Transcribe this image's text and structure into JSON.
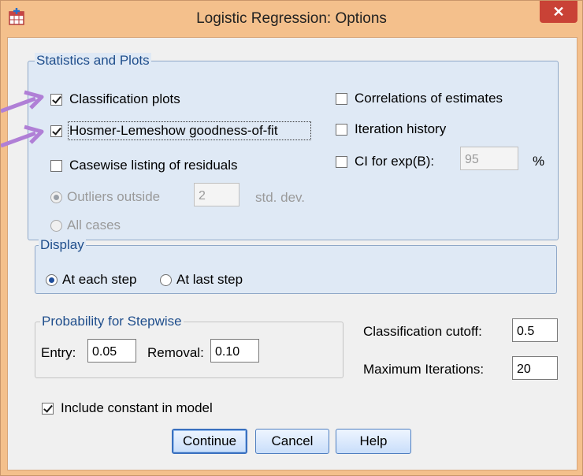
{
  "window": {
    "title": "Logistic Regression: Options",
    "close_glyph": "✕"
  },
  "stats_group": {
    "legend": "Statistics and Plots",
    "classification_plots": {
      "label": "Classification plots",
      "checked": true
    },
    "hosmer": {
      "label": "Hosmer-Lemeshow goodness-of-fit",
      "checked": true
    },
    "casewise": {
      "label": "Casewise listing of residuals",
      "checked": false
    },
    "outliers": {
      "label": "Outliers outside",
      "value": "2",
      "unit": "std. dev."
    },
    "all_cases": {
      "label": "All cases"
    },
    "correlations": {
      "label": "Correlations of estimates",
      "checked": false
    },
    "iteration_history": {
      "label": "Iteration history",
      "checked": false
    },
    "ci": {
      "label": "CI for exp(B):",
      "value": "95",
      "unit": "%"
    }
  },
  "display_group": {
    "legend": "Display",
    "each_step": "At each step",
    "last_step": "At last step"
  },
  "stepwise_group": {
    "legend": "Probability for Stepwise",
    "entry_label": "Entry:",
    "entry_value": "0.05",
    "removal_label": "Removal:",
    "removal_value": "0.10"
  },
  "cutoff": {
    "label": "Classification cutoff:",
    "value": "0.5"
  },
  "max_iter": {
    "label": "Maximum Iterations:",
    "value": "20"
  },
  "include_constant": {
    "label": "Include constant in model",
    "checked": true
  },
  "buttons": {
    "continue": "Continue",
    "cancel": "Cancel",
    "help": "Help"
  },
  "colors": {
    "title_bar": "#f4c08c",
    "group_fill": "#dfe9f5",
    "arrow": "#b07fd6",
    "close": "#c94236"
  },
  "icons": [
    "spss-app-icon",
    "close-icon",
    "annotation-arrow-icon"
  ]
}
